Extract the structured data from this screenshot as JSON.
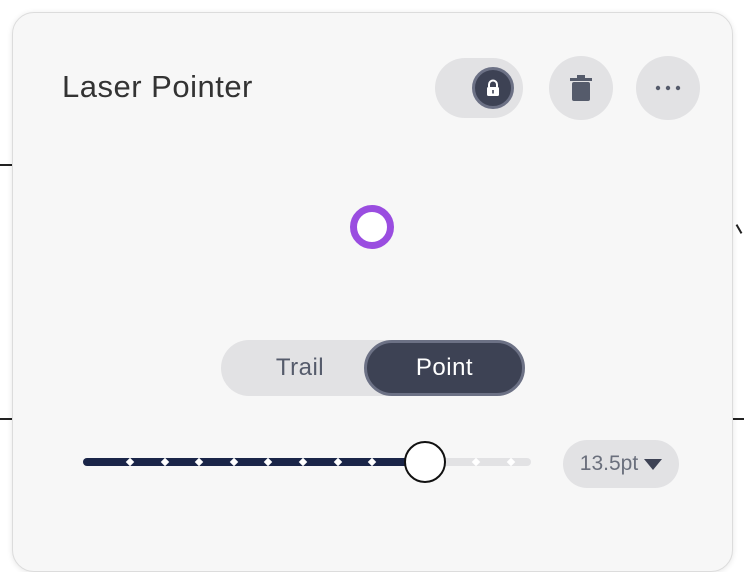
{
  "panel": {
    "title": "Laser Pointer"
  },
  "header": {
    "lock_icon": "lock-icon",
    "trash_icon": "trash-icon",
    "more_icon": "more-horizontal-icon",
    "locked": true
  },
  "preview": {
    "ring_color": "#9a4de0"
  },
  "mode": {
    "options": [
      "Trail",
      "Point"
    ],
    "selected": "Point"
  },
  "size": {
    "value_label": "13.5pt",
    "steps": 12,
    "selected_step": 10,
    "fill_fraction": 0.79,
    "track_fill_color": "#1a2548"
  },
  "colors": {
    "accent_dark": "#3d4254",
    "accent_border": "#6c7185",
    "control_bg": "#e2e2e4",
    "panel_bg": "#f7f7f7"
  }
}
